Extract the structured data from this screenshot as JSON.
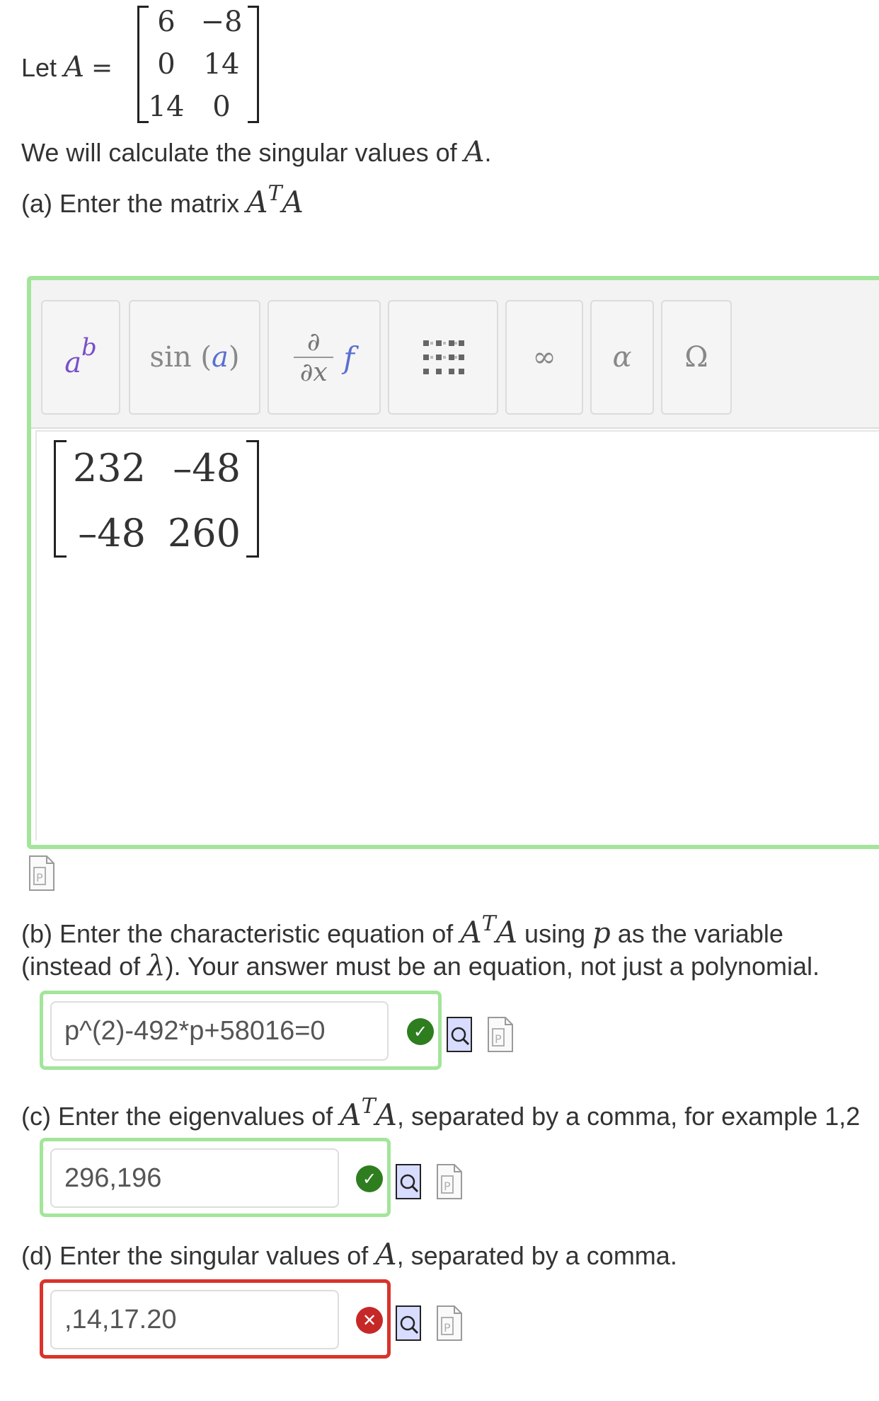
{
  "problem": {
    "let_prefix": "Let",
    "matrix_name": "A",
    "equals": "=",
    "matrix_A": [
      [
        "6",
        "−8"
      ],
      [
        "0",
        "14"
      ],
      [
        "14",
        "0"
      ]
    ],
    "intro_text": "We will calculate the singular values of",
    "intro_var": "A",
    "intro_end": "."
  },
  "part_a": {
    "label": "(a) Enter the matrix",
    "math_base": "A",
    "math_sup": "T",
    "math_end": "A"
  },
  "editor": {
    "toolbar": {
      "power_base": "a",
      "power_exp": "b",
      "trig": "sin",
      "trig_open": "(",
      "trig_arg": "a",
      "trig_close": ")",
      "deriv_num": "∂",
      "deriv_den": "∂x",
      "deriv_f": "f",
      "infinity": "∞",
      "alpha": "α",
      "omega": "Ω"
    },
    "answer_matrix": [
      [
        "232",
        "–48"
      ],
      [
        "–48",
        "260"
      ]
    ]
  },
  "part_b": {
    "line1_pre": "(b) Enter the characteristic equation of",
    "math_base": "A",
    "math_sup": "T",
    "math_end": "A",
    "line1_mid": "using",
    "var": "p",
    "line1_post": "as the variable",
    "line2_pre": "(instead of",
    "lambda": "λ",
    "line2_post": "). Your answer must be an equation, not just a polynomial.",
    "answer": "p^(2)-492*p+58016=0",
    "status": "correct"
  },
  "part_c": {
    "label_pre": "(c) Enter the eigenvalues of",
    "math_base": "A",
    "math_sup": "T",
    "math_end": "A",
    "label_post": ", separated by a comma, for example 1,2",
    "answer": "296,196",
    "status": "correct"
  },
  "part_d": {
    "label_pre": "(d) Enter the singular values of",
    "var": "A",
    "label_post": ", separated by a comma.",
    "answer": ",14,17.20",
    "status": "incorrect"
  },
  "icons": {
    "check": "✓",
    "cross": "✕"
  },
  "colors": {
    "correct_border": "#a3e59a",
    "wrong_border": "#d9332b",
    "ok_icon": "#2e7d1f",
    "bad_icon": "#c62828"
  }
}
